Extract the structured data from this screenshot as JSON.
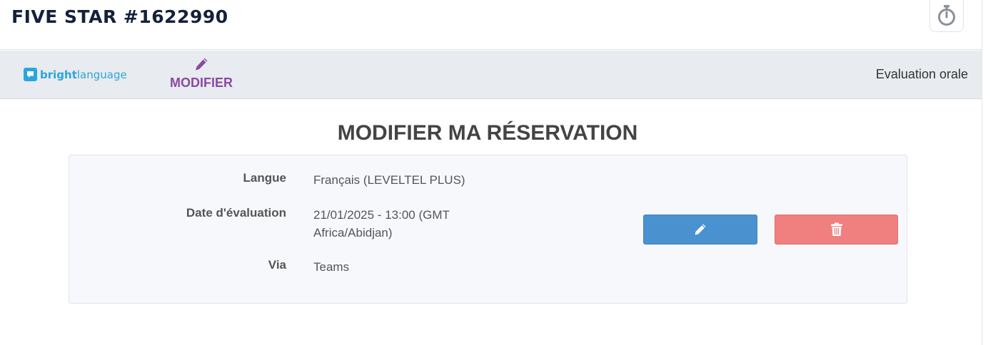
{
  "header": {
    "title": "FIVE STAR #1622990",
    "timer_icon": "stopwatch-icon"
  },
  "nav": {
    "logo": {
      "bold": "bright",
      "light": "language"
    },
    "modifier_label": "MODIFIER",
    "modifier_icon": "pencil-icon",
    "right_label": "Evaluation orale"
  },
  "main": {
    "section_title": "MODIFIER MA RÉSERVATION",
    "details": [
      {
        "label": "Langue",
        "value": "Français (LEVELTEL PLUS)"
      },
      {
        "label": "Date d'évaluation",
        "value": "21/01/2025 - 13:00 (GMT Africa/Abidjan)"
      },
      {
        "label": "Via",
        "value": "Teams"
      }
    ],
    "actions": {
      "edit_icon": "pencil-icon",
      "delete_icon": "trash-icon"
    }
  },
  "colors": {
    "accent_purple": "#8a4aa3",
    "edit_blue": "#4a92cf",
    "delete_red": "#f08080",
    "brand_blue": "#2aa6df"
  }
}
